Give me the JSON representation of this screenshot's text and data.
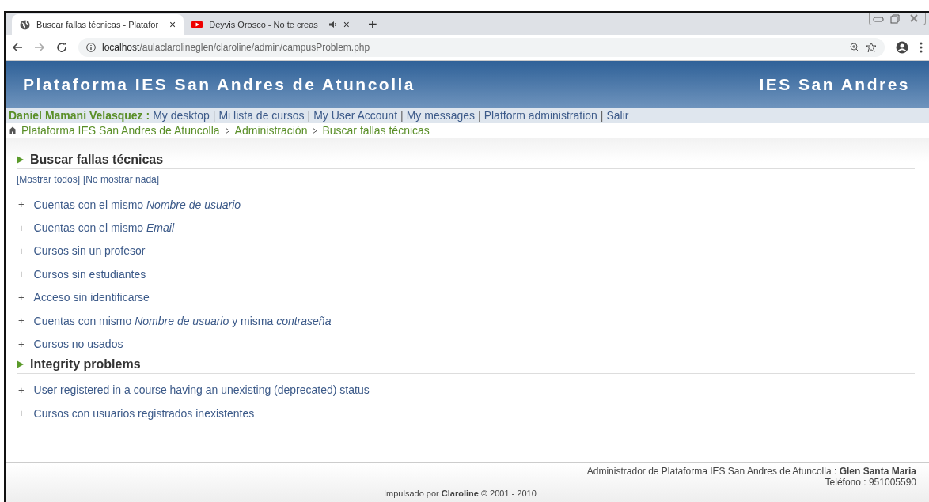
{
  "browser": {
    "tabs": [
      {
        "title": "Buscar fallas técnicas - Platafor",
        "close": "×",
        "selected": true,
        "kind": "globe"
      },
      {
        "title": "Deyvis Orosco - No te creas",
        "close": "×",
        "selected": false,
        "kind": "video"
      }
    ],
    "new_tab": "+",
    "url_host": "localhost",
    "url_path": "/aulaclarolineglen/claroline/admin/campusProblem.php"
  },
  "banner": {
    "title": "Plataforma IES San Andres de Atuncolla",
    "institution": "IES San Andres"
  },
  "user_bar": {
    "user": "Daniel Mamani Velasquez :",
    "separator": "|",
    "links": [
      "My desktop",
      "Mi lista de cursos",
      "My User Account",
      "My messages",
      "Platform administration",
      "Salir"
    ]
  },
  "breadcrumb": [
    "Plataforma IES San Andres de Atuncolla",
    "Administración",
    "Buscar fallas técnicas"
  ],
  "sections": [
    {
      "title": "Buscar fallas técnicas",
      "toggles": [
        "[Mostrar todos]",
        "[No mostrar nada]"
      ],
      "items": [
        {
          "toggle": "+",
          "label": "Cuentas con el mismo *Nombre de usuario*"
        },
        {
          "toggle": "+",
          "label": "Cuentas con el mismo *Email*"
        },
        {
          "toggle": "+",
          "label": "Cursos sin un profesor"
        },
        {
          "toggle": "+",
          "label": "Cursos sin estudiantes"
        },
        {
          "toggle": "+",
          "label": "Acceso sin identificarse"
        },
        {
          "toggle": "+",
          "label": "Cuentas con mismo *Nombre de usuario* y misma *contraseña*"
        },
        {
          "toggle": "+",
          "label": "Cursos no usados"
        }
      ]
    },
    {
      "title": "Integrity problems",
      "items": [
        {
          "toggle": "+",
          "label": "User registered in a course having an unexisting (deprecated) status"
        },
        {
          "toggle": "+",
          "label": "Cursos con usuarios registrados inexistentes"
        }
      ]
    }
  ],
  "footer": {
    "admin": "Administrador de Plataforma IES San Andres de Atuncolla : **Glen Santa Maria**",
    "phone": "Teléfono : 951005590",
    "powered": "Impulsado por **Claroline** © 2001 - 2010"
  }
}
